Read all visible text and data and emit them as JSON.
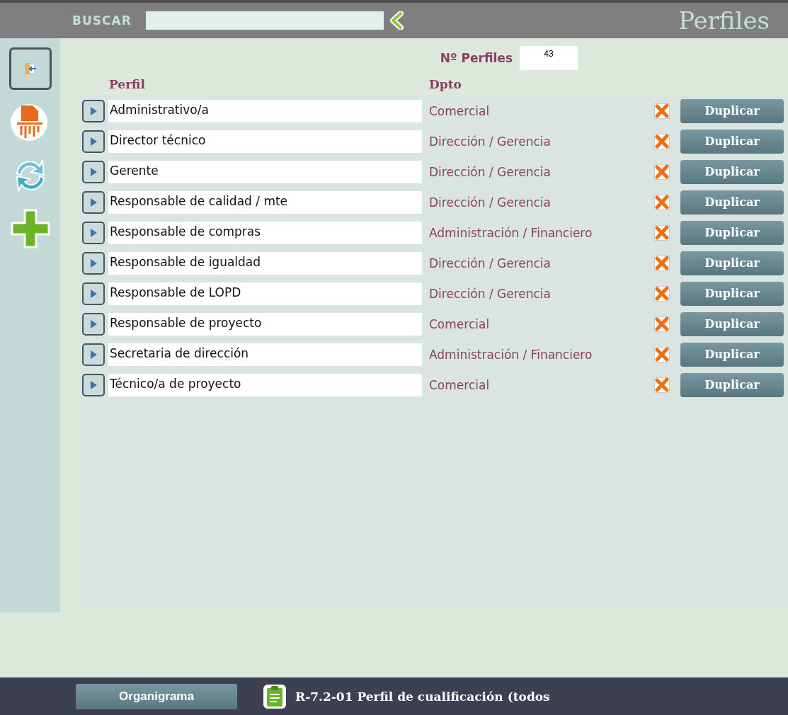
{
  "header": {
    "search_label": "BUSCAR",
    "title": "Perfiles"
  },
  "count": {
    "label": "Nº Perfiles",
    "value": "43"
  },
  "table": {
    "columns": [
      "Perfil",
      "Dpto"
    ],
    "rows": [
      {
        "perfil": "Administrativo/a",
        "dpto": "Comercial",
        "checked": true,
        "action": "Duplicar"
      },
      {
        "perfil": "Director técnico",
        "dpto": "Dirección / Gerencia",
        "checked": true,
        "action": "Duplicar"
      },
      {
        "perfil": "Gerente",
        "dpto": "Dirección / Gerencia",
        "checked": true,
        "action": "Duplicar"
      },
      {
        "perfil": "Responsable de calidad / mte",
        "dpto": "Dirección / Gerencia",
        "checked": true,
        "action": "Duplicar"
      },
      {
        "perfil": "Responsable de compras",
        "dpto": "Administración / Financiero",
        "checked": true,
        "action": "Duplicar"
      },
      {
        "perfil": "Responsable de igualdad",
        "dpto": "Dirección / Gerencia",
        "checked": true,
        "action": "Duplicar"
      },
      {
        "perfil": "Responsable de LOPD",
        "dpto": "Dirección / Gerencia",
        "checked": true,
        "action": "Duplicar"
      },
      {
        "perfil": "Responsable de proyecto",
        "dpto": "Comercial",
        "checked": true,
        "action": "Duplicar"
      },
      {
        "perfil": "Secretaria de dirección",
        "dpto": "Administración / Financiero",
        "checked": true,
        "action": "Duplicar"
      },
      {
        "perfil": "Técnico/a de proyecto",
        "dpto": "Comercial",
        "checked": true,
        "action": "Duplicar"
      }
    ]
  },
  "footer": {
    "button": "Organigrama",
    "report": "R-7.2-01 Perfil de cualificación (todos"
  }
}
